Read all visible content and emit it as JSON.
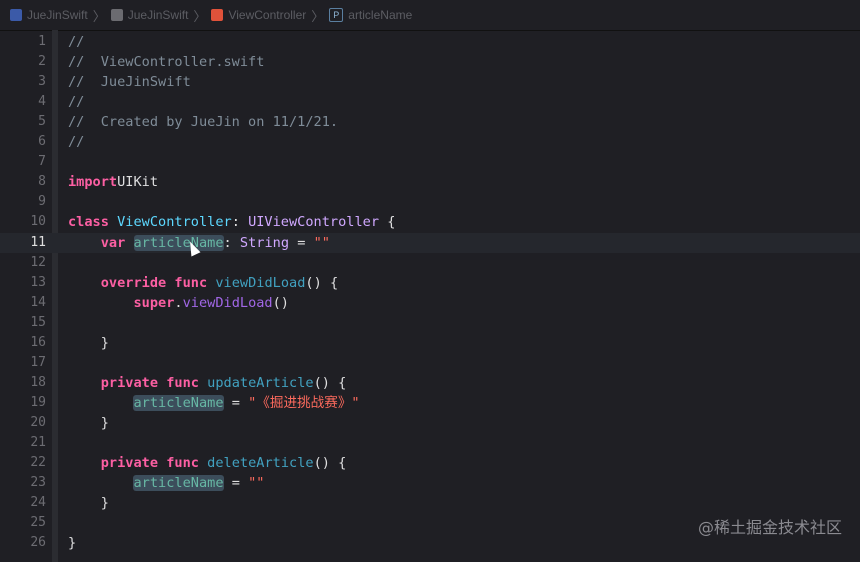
{
  "breadcrumb": [
    {
      "label": "JueJinSwift",
      "icon": "project-icon"
    },
    {
      "label": "JueJinSwift",
      "icon": "folder-icon"
    },
    {
      "label": "ViewController",
      "icon": "swift-file-icon"
    },
    {
      "label": "articleName",
      "icon": "property-icon",
      "badge": "P"
    }
  ],
  "current_line": 11,
  "lines": [
    [
      [
        "cm",
        "//"
      ]
    ],
    [
      [
        "cm",
        "//  ViewController.swift"
      ]
    ],
    [
      [
        "cm",
        "//  JueJinSwift"
      ]
    ],
    [
      [
        "cm",
        "//"
      ]
    ],
    [
      [
        "cm",
        "//  Created by JueJin on 11/1/21."
      ]
    ],
    [
      [
        "cm",
        "//"
      ]
    ],
    [],
    [
      [
        "kw",
        "import"
      ],
      [
        "",
        "UIKit"
      ]
    ],
    [],
    [
      [
        "kw",
        "class"
      ],
      [
        "",
        " "
      ],
      [
        "td",
        "ViewController"
      ],
      [
        "",
        ": "
      ],
      [
        "ty",
        "UIViewController"
      ],
      [
        "",
        " {"
      ]
    ],
    [
      [
        "",
        "    "
      ],
      [
        "kw",
        "var"
      ],
      [
        "",
        " "
      ],
      [
        "hl",
        "articleName"
      ],
      [
        "",
        ": "
      ],
      [
        "ty",
        "String"
      ],
      [
        "",
        " = "
      ],
      [
        "st",
        "\"\""
      ]
    ],
    [],
    [
      [
        "",
        "    "
      ],
      [
        "kw",
        "override"
      ],
      [
        "",
        " "
      ],
      [
        "kw",
        "func"
      ],
      [
        "",
        " "
      ],
      [
        "fd",
        "viewDidLoad"
      ],
      [
        "",
        "() {"
      ]
    ],
    [
      [
        "",
        "        "
      ],
      [
        "kw",
        "super"
      ],
      [
        "",
        "."
      ],
      [
        "fn",
        "viewDidLoad"
      ],
      [
        "",
        "()"
      ]
    ],
    [],
    [
      [
        "",
        "    }"
      ]
    ],
    [],
    [
      [
        "",
        "    "
      ],
      [
        "kw",
        "private"
      ],
      [
        "",
        " "
      ],
      [
        "kw",
        "func"
      ],
      [
        "",
        " "
      ],
      [
        "fd",
        "updateArticle"
      ],
      [
        "",
        "() {"
      ]
    ],
    [
      [
        "",
        "        "
      ],
      [
        "hl",
        "articleName"
      ],
      [
        "",
        " = "
      ],
      [
        "st",
        "\"《掘进挑战赛》\""
      ]
    ],
    [
      [
        "",
        "    }"
      ]
    ],
    [],
    [
      [
        "",
        "    "
      ],
      [
        "kw",
        "private"
      ],
      [
        "",
        " "
      ],
      [
        "kw",
        "func"
      ],
      [
        "",
        " "
      ],
      [
        "fd",
        "deleteArticle"
      ],
      [
        "",
        "() {"
      ]
    ],
    [
      [
        "",
        "        "
      ],
      [
        "hl",
        "articleName"
      ],
      [
        "",
        " = "
      ],
      [
        "st",
        "\"\""
      ]
    ],
    [
      [
        "",
        "    }"
      ]
    ],
    [],
    [
      [
        "",
        "}"
      ]
    ]
  ],
  "watermark": "@稀土掘金技术社区"
}
